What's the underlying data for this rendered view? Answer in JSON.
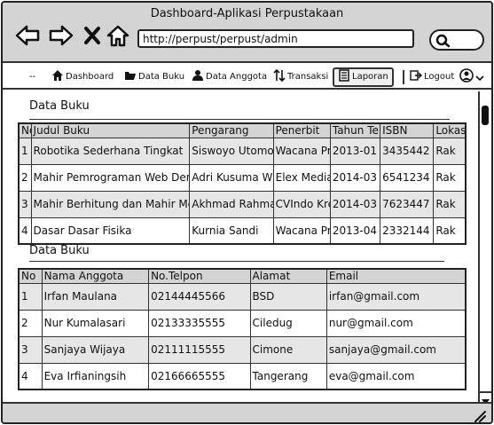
{
  "window": {
    "title": "Dashboard-Aplikasi Perpustakaan"
  },
  "browser": {
    "url": "http://perpust/perpust/admin"
  },
  "menu": {
    "items": [
      {
        "label": "--",
        "icon": ""
      },
      {
        "label": "Dashboard",
        "icon": "home-icon"
      },
      {
        "label": "Data Buku",
        "icon": "folder-icon"
      },
      {
        "label": "Data Anggota",
        "icon": "user-icon"
      },
      {
        "label": "Transaksi",
        "icon": "sort-icon"
      },
      {
        "label": "Laporan",
        "icon": "report-icon"
      },
      {
        "label": "Logout",
        "icon": "logout-icon"
      }
    ]
  },
  "books": {
    "title": "Data Buku",
    "headers": [
      "No",
      "Judul Buku",
      "Pengarang",
      "Penerbit",
      "Tahun Terbit",
      "ISBN",
      "Lokasi"
    ],
    "rows": [
      [
        "1",
        "Robotika Sederhana Tingkat",
        "Siswoyo Utomo",
        "Wacana Prima",
        "2013-01",
        "3435442",
        "Rak"
      ],
      [
        "2",
        "Mahir Pemrograman Web Den",
        "Adri Kusuma W",
        "Elex Media",
        "2014-03",
        "6541234",
        "Rak"
      ],
      [
        "3",
        "Mahir Berhitung dan Mahir Me",
        "Akhmad Rahmat",
        "CVIndo Kreasi",
        "2014-03",
        "7623447",
        "Rak"
      ],
      [
        "4",
        "Dasar Dasar Fisika",
        "Kurnia Sandi",
        "Wacana Prima",
        "2013-04",
        "2332144",
        "Rak"
      ]
    ]
  },
  "members": {
    "title": "Data Buku",
    "headers": [
      "No",
      "Nama Anggota",
      "No.Telpon",
      "Alamat",
      "Email"
    ],
    "rows": [
      [
        "1",
        "Irfan Maulana",
        "02144445566",
        "BSD",
        "irfan@gmail.com"
      ],
      [
        "2",
        "Nur Kumalasari",
        "02133335555",
        "Ciledug",
        "nur@gmail.com"
      ],
      [
        "3",
        "Sanjaya Wijaya",
        "02111115555",
        "Cimone",
        "sanjaya@gmail.com"
      ],
      [
        "4",
        "Eva Irfianingsih",
        "02166665555",
        "Tangerang",
        "eva@gmail.com"
      ]
    ]
  }
}
